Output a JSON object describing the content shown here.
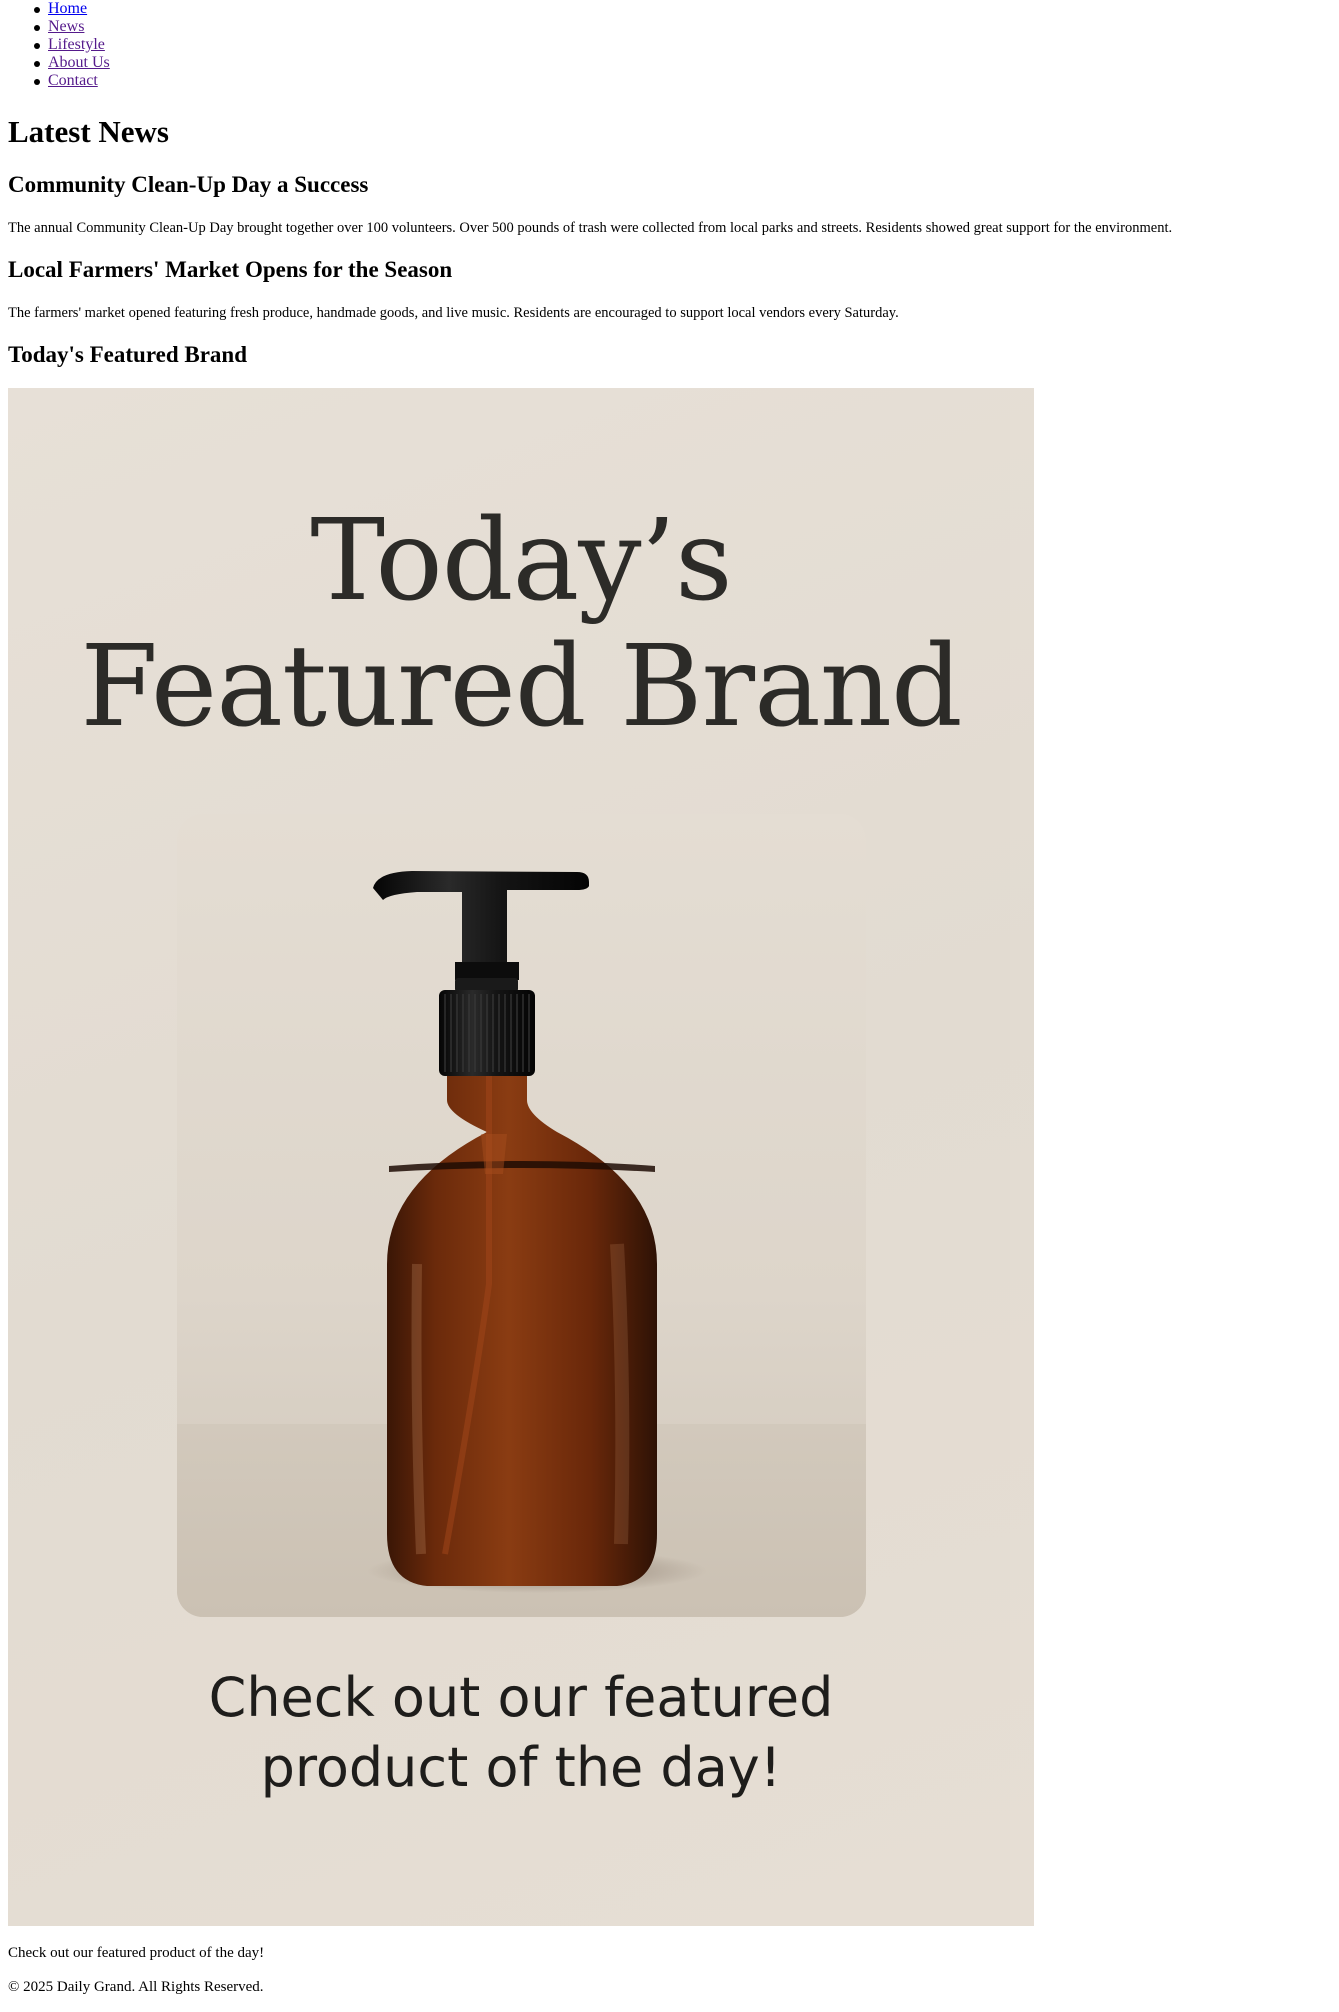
{
  "nav": {
    "items": [
      {
        "label": "Home"
      },
      {
        "label": "News"
      },
      {
        "label": "Lifestyle"
      },
      {
        "label": "About Us"
      },
      {
        "label": "Contact"
      }
    ]
  },
  "main": {
    "heading": "Latest News",
    "articles": [
      {
        "title": "Community Clean-Up Day a Success",
        "body": "The annual Community Clean-Up Day brought together over 100 volunteers. Over 500 pounds of trash were collected from local parks and streets. Residents showed great support for the environment."
      },
      {
        "title": "Local Farmers' Market Opens for the Season",
        "body": "The farmers' market opened featuring fresh produce, handmade goods, and live music. Residents are encouraged to support local vendors every Saturday."
      }
    ],
    "featured": {
      "heading": "Today's Featured Brand",
      "banner_title_line1": "Today’s",
      "banner_title_line2": "Featured Brand",
      "banner_caption_line1": "Check out our featured",
      "banner_caption_line2": "product of the day!",
      "caption": "Check out our featured product of the day!"
    }
  },
  "footer": {
    "text": "© 2025 Daily Grand. All Rights Reserved."
  },
  "colors": {
    "link": "#0000ee",
    "visited_link": "#551a8b",
    "banner_bg": "#e4ddd3",
    "banner_text": "#2c2b28",
    "bottle_amber": "#7a3510",
    "pump_black": "#111111"
  }
}
